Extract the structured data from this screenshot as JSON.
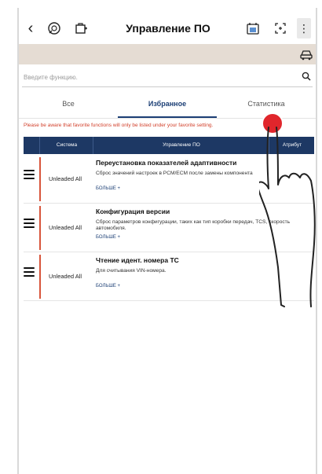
{
  "header": {
    "back_icon": "back-arrow-icon",
    "title": "Управление ПО"
  },
  "search": {
    "placeholder": "Введите функцию."
  },
  "tabs": [
    {
      "label": "Все"
    },
    {
      "label": "Избранное"
    },
    {
      "label": "Статистика"
    }
  ],
  "notice": "Please be aware that favorite functions will only be listed under your favorite setting.",
  "table": {
    "headers": [
      "Система",
      "Управление ПО",
      "Атрибут"
    ],
    "rows": [
      {
        "system": "Unleaded All",
        "title": "Переустановка показателей адаптивности",
        "description": "Сброс значений настроек в PCM/ECM после замены компонента",
        "more": "БОЛЬШЕ +"
      },
      {
        "system": "Unleaded All",
        "title": "Конфигурация версии",
        "description": "Сброс параметров конфигурации, таких как тип коробки передач, TCS, скорость автомобиля.",
        "more": "БОЛЬШЕ +"
      },
      {
        "system": "Unleaded All",
        "title": "Чтение идент. номера ТС",
        "description": "Для считывания VIN-номера.",
        "more": "БОЛЬШЕ +"
      }
    ]
  },
  "colors": {
    "header_bg": "#1d3864",
    "accent_red": "#d8553b",
    "beige_bar": "#e5dcd3",
    "tap_dot": "#e0262c"
  }
}
